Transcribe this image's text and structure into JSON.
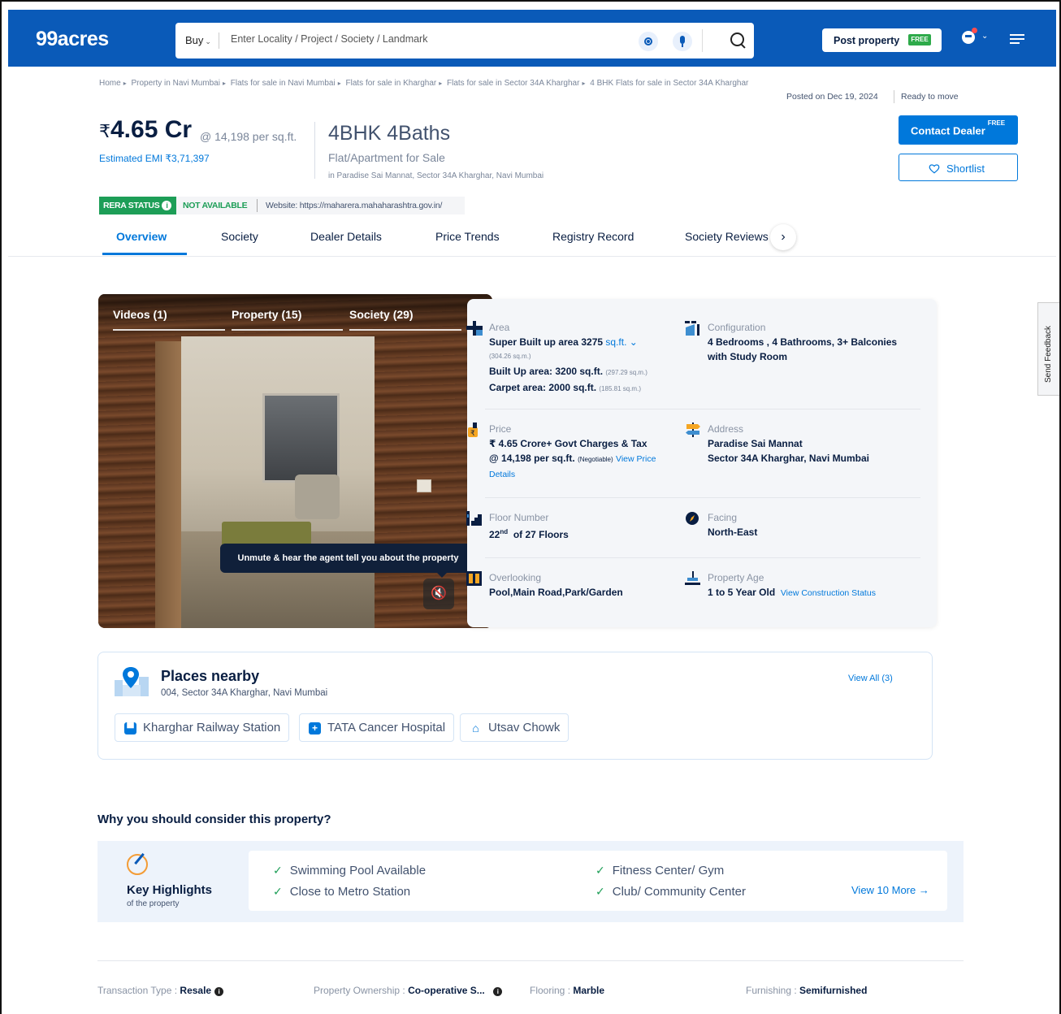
{
  "header": {
    "logo": "99acres",
    "buy_label": "Buy",
    "search_placeholder": "Enter Locality / Project / Society / Landmark",
    "post_property": "Post property",
    "free_tag": "FREE",
    "brand_color": "#0A5AB8"
  },
  "breadcrumb": [
    "Home",
    "Property in Navi Mumbai",
    "Flats for sale in Navi Mumbai",
    "Flats for sale in Kharghar",
    "Flats for sale in Sector 34A Kharghar",
    "4 BHK Flats for sale in Sector 34A Kharghar"
  ],
  "meta": {
    "posted": "Posted on Dec 19, 2024",
    "status": "Ready to move"
  },
  "listing": {
    "currency": "₹",
    "price": "4.65 Cr",
    "price_per_sqft": "@ 14,198 per sq.ft.",
    "emi": "Estimated EMI ₹3,71,397",
    "title": "4BHK 4Baths",
    "type": "Flat/Apartment for Sale",
    "location": "in Paradise Sai Mannat, Sector 34A Kharghar, Navi Mumbai",
    "contact_btn": "Contact Dealer",
    "contact_sup": "FREE",
    "shortlist_btn": "Shortlist"
  },
  "rera": {
    "label": "RERA STATUS",
    "value": "NOT AVAILABLE",
    "website": "Website: https://maharera.mahaharashtra.gov.in/"
  },
  "tabs": [
    "Overview",
    "Society",
    "Dealer Details",
    "Price Trends",
    "Registry Record",
    "Society Reviews"
  ],
  "media": {
    "tabs": [
      "Videos (1)",
      "Property (15)",
      "Society (29)"
    ],
    "tooltip": "Unmute & hear the agent tell you about the property"
  },
  "details": {
    "area": {
      "label": "Area",
      "super": "Super Built up area 3275",
      "unit": "sq.ft.",
      "super_sqm": "(304.26 sq.m.)",
      "built": "Built Up area: 3200 sq.ft.",
      "built_sqm": "(297.29 sq.m.)",
      "carpet": "Carpet area: 2000 sq.ft.",
      "carpet_sqm": "(185.81 sq.m.)"
    },
    "configuration": {
      "label": "Configuration",
      "line1": "4 Bedrooms , 4 Bathrooms, 3+ Balconies",
      "line2": "with Study Room"
    },
    "price": {
      "label": "Price",
      "line1": "₹ 4.65 Crore+ Govt Charges & Tax",
      "line2": "@ 14,198 per sq.ft.",
      "negotiable": "(Negotiable)",
      "link1": "View Price",
      "link2": "Details"
    },
    "address": {
      "label": "Address",
      "line1": "Paradise Sai Mannat",
      "line2": "Sector 34A Kharghar, Navi Mumbai"
    },
    "floor": {
      "label": "Floor Number",
      "num": "22",
      "sup": "nd",
      "rest": "of 27 Floors"
    },
    "facing": {
      "label": "Facing",
      "value": "North-East"
    },
    "overlooking": {
      "label": "Overlooking",
      "value": "Pool,Main Road,Park/Garden"
    },
    "age": {
      "label": "Property Age",
      "value": "1 to 5 Year Old",
      "link": "View Construction Status"
    }
  },
  "places": {
    "title": "Places nearby",
    "address": "004, Sector 34A Kharghar, Navi Mumbai",
    "view_all": "View All (3)",
    "items": [
      "Kharghar Railway Station",
      "TATA Cancer Hospital",
      "Utsav Chowk"
    ]
  },
  "consider": {
    "title": "Why you should consider this property?",
    "box_title": "Key Highlights",
    "box_sub": "of the property",
    "items": [
      "Swimming Pool Available",
      "Close to Metro Station",
      "Fitness Center/ Gym",
      "Club/ Community Center"
    ],
    "more": "View 10 More →"
  },
  "facts": [
    {
      "label": "Transaction Type",
      "value": "Resale"
    },
    {
      "label": "Property Ownership",
      "value": "Co-operative S..."
    },
    {
      "label": "Flooring",
      "value": "Marble"
    },
    {
      "label": "Furnishing",
      "value": "Semifurnished"
    }
  ],
  "feedback": "Send Feedback"
}
